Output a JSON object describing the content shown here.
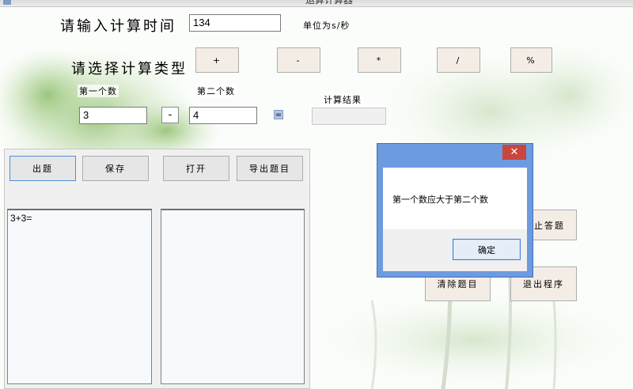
{
  "window": {
    "title": "运算计算器"
  },
  "time_row": {
    "label": "请输入计算时间",
    "value": "134",
    "unit": "单位为s/秒"
  },
  "op_row": {
    "label": "请选择计算类型",
    "ops": [
      "+",
      "-",
      "*",
      "/",
      "%"
    ]
  },
  "operands": {
    "first_label": "第一个数",
    "first_value": "3",
    "operator": "-",
    "second_label": "第二个数",
    "second_value": "4",
    "equals": "=",
    "result_label": "计算结果",
    "result_value": ""
  },
  "panel": {
    "buttons": [
      "出题",
      "保存",
      "打开",
      "导出题目"
    ],
    "questions": "3+3=",
    "answers": ""
  },
  "right_buttons": {
    "stop": "止答题",
    "clear": "清除题目",
    "exit": "退出程序"
  },
  "dialog": {
    "close": "✕",
    "message": "第一个数应大于第二个数",
    "ok": "确定"
  }
}
